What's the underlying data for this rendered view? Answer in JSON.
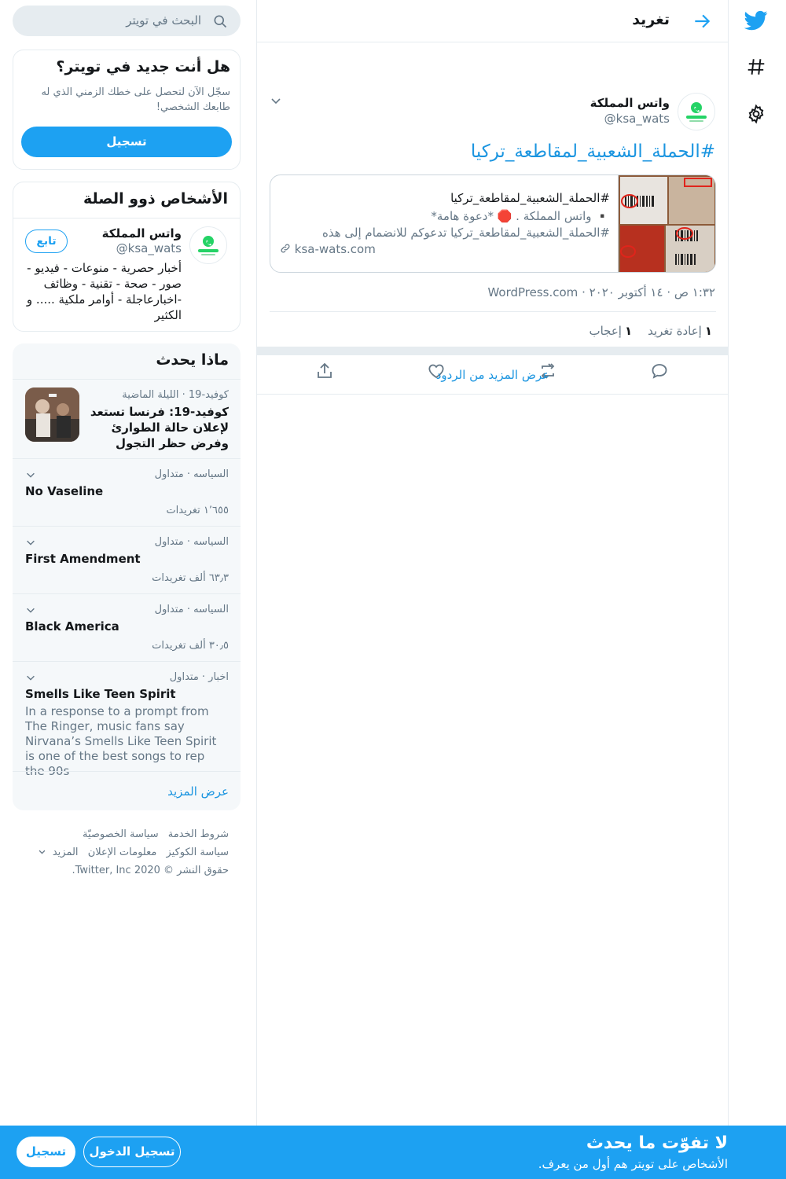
{
  "header": {
    "title": "تغريد"
  },
  "tweet": {
    "author_name": "واتس المملكة",
    "author_handle": "@ksa_wats",
    "text": "#الحملة_الشعبية_لمقاطعة_تركيا",
    "card": {
      "title": "#الحملة_الشعبية_لمقاطعة_تركيا",
      "description_line1": "▪️ واتس المملكة . 🛑 *دعوة هامة*",
      "description_line2": "#الحملة_الشعبية_لمقاطعة_تركيا    تدعوكم للانضمام إلى هذه",
      "link": "ksa-wats.com"
    },
    "meta": "١:٣٢ ص · ١٤ أكتوبر ٢٠٢٠ · WordPress.com",
    "retweets_count": "١",
    "retweets_label": "إعادة تغريد",
    "likes_count": "١",
    "likes_label": "إعجاب",
    "more_replies": "عرض المزيد من الردود"
  },
  "search": {
    "placeholder": "البحث في تويتر"
  },
  "new_to_twitter": {
    "title": "هل أنت جديد في تويتر؟",
    "text": "سجّل الآن لتحصل على خطك الزمني الذي له طابعك الشخصي!",
    "signup": "تسجيل"
  },
  "relevant_people": {
    "title": "الأشخاص ذوو الصلة",
    "name": "واتس المملكة",
    "handle": "@ksa_wats",
    "bio": "أخبار حصرية - منوعات - فيديو - صور - صحة - تقنية - وظائف -اخبارعاجلة - أوامر ملكية ..... و الكثير",
    "follow": "تابع"
  },
  "trends": {
    "title": "ماذا يحدث",
    "news": {
      "meta": "كوفيد-19 · الليلة الماضية",
      "title": "كوفيد-19: فرنسا تستعد لإعلان حالة الطوارئ وفرض حظر التجول"
    },
    "items": [
      {
        "meta": "السياسه · متداول",
        "title": "No Vaseline",
        "count": "١٬٦٥٥ تغريدات"
      },
      {
        "meta": "السياسه · متداول",
        "title": "First Amendment",
        "count": "٦٣٫٣ ألف تغريدات"
      },
      {
        "meta": "السياسه · متداول",
        "title": "Black America",
        "count": "٣٠٫٥ ألف تغريدات"
      },
      {
        "meta": "اخبار · متداول",
        "title": "Smells Like Teen Spirit",
        "description": "In a response to a prompt from The Ringer, music fans say Nirvana’s Smells Like Teen Spirit is one of the best songs to rep the 90s"
      }
    ],
    "show_more": "عرض المزيد"
  },
  "footer": {
    "terms": "شروط الخدمة",
    "privacy": "سياسة الخصوصيّة",
    "cookies": "سياسة الكوكيز",
    "ads": "معلومات الإعلان",
    "more": "المزيد",
    "copyright": "حقوق النشر © 2020 Twitter, Inc."
  },
  "banner": {
    "title": "لا تفوّت ما يحدث",
    "subtitle": "الأشخاص على تويتر هم أول من يعرف.",
    "login": "تسجيل الدخول",
    "signup": "تسجيل"
  },
  "colors": {
    "brand": "#1da1f2",
    "link": "#1b95e0",
    "muted": "#657786",
    "border": "#e6ecf0"
  }
}
